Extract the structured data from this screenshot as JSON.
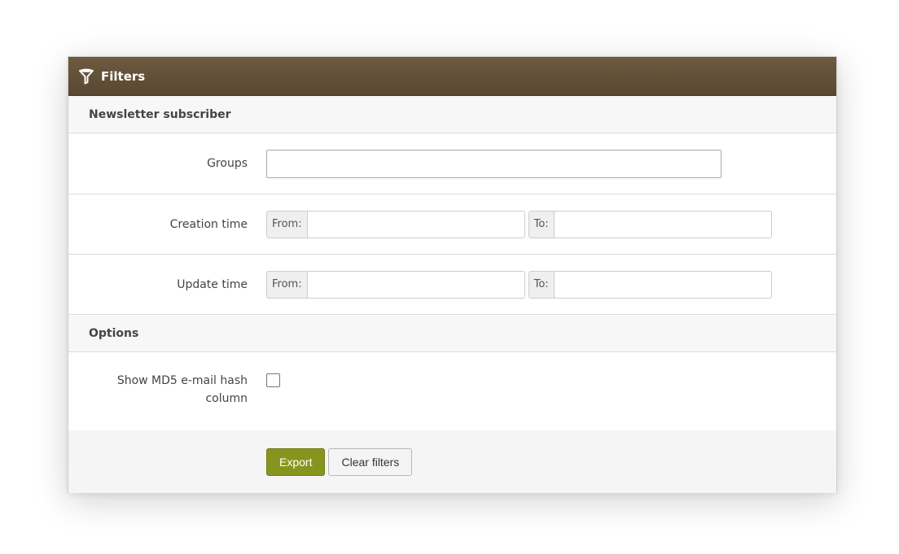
{
  "header": {
    "title": "Filters",
    "icon": "filter-icon"
  },
  "sections": {
    "subscriber": {
      "title": "Newsletter subscriber"
    },
    "options": {
      "title": "Options"
    }
  },
  "fields": {
    "groups": {
      "label": "Groups",
      "value": ""
    },
    "creation_time": {
      "label": "Creation time",
      "from_label": "From:",
      "to_label": "To:",
      "from_value": "",
      "to_value": ""
    },
    "update_time": {
      "label": "Update time",
      "from_label": "From:",
      "to_label": "To:",
      "from_value": "",
      "to_value": ""
    },
    "show_md5": {
      "label": "Show MD5 e-mail hash column",
      "checked": false
    }
  },
  "actions": {
    "export_label": "Export",
    "clear_label": "Clear filters"
  },
  "colors": {
    "header_bg": "#5f4c35",
    "primary_button": "#87951f"
  }
}
